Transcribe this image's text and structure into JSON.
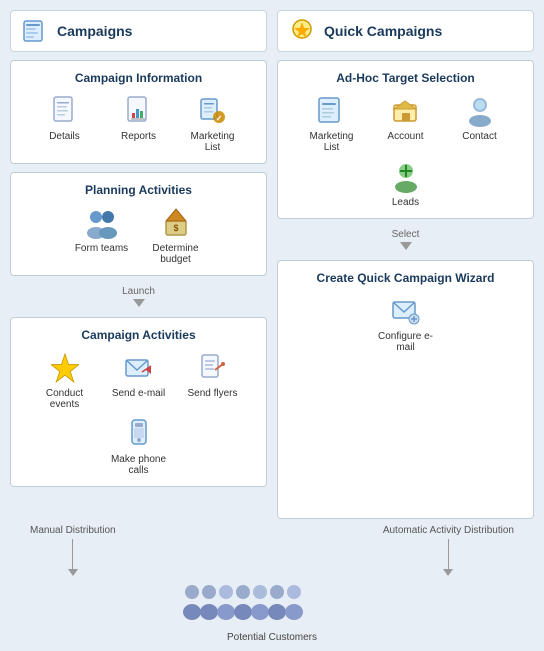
{
  "left_column": {
    "header": "Campaigns",
    "campaign_info": {
      "title": "Campaign Information",
      "items": [
        "Details",
        "Reports",
        "Marketing List"
      ]
    },
    "planning": {
      "title": "Planning Activities",
      "items": [
        "Form teams",
        "Determine budget"
      ]
    },
    "launch_label": "Launch",
    "campaign_activities": {
      "title": "Campaign Activities",
      "items": [
        "Conduct events",
        "Send e-mail",
        "Send flyers",
        "Make phone calls"
      ]
    }
  },
  "right_column": {
    "header": "Quick Campaigns",
    "adhoc": {
      "title": "Ad-Hoc Target Selection",
      "items": [
        "Marketing List",
        "Account",
        "Contact",
        "Leads"
      ]
    },
    "select_label": "Select",
    "wizard": {
      "title": "Create Quick Campaign Wizard",
      "items": [
        "Configure e-mail"
      ]
    }
  },
  "bottom": {
    "manual_label": "Manual Distribution",
    "auto_label": "Automatic Activity Distribution",
    "customers_label": "Potential Customers"
  }
}
